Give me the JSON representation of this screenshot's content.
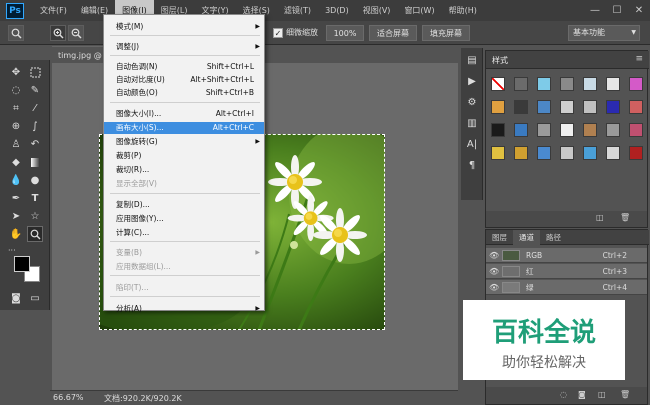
{
  "app": {
    "logo": "Ps"
  },
  "menubar": {
    "items": [
      "文件(F)",
      "编辑(E)",
      "图像(I)",
      "图层(L)",
      "文字(Y)",
      "选择(S)",
      "滤镜(T)",
      "3D(D)",
      "视图(V)",
      "窗口(W)",
      "帮助(H)"
    ],
    "active_index": 2,
    "window_controls": {
      "minimize": "—",
      "maximize": "☐",
      "close": "✕"
    }
  },
  "options_bar": {
    "tool_icon": "zoom-icon",
    "checkbox_label": "细微缩放",
    "zoom_percent_button": "100%",
    "fit_screen_button": "适合屏幕",
    "fill_screen_button": "填充屏幕",
    "workspace": "基本功能"
  },
  "document": {
    "tab_label": "timg.jpg @ 6",
    "zoom": "66.67%",
    "doc_info": "文档:920.2K/920.2K"
  },
  "image_menu": {
    "items": [
      {
        "label": "模式(M)",
        "shortcut": "",
        "submenu": true,
        "disabled": false
      },
      {
        "label": "调整(J)",
        "shortcut": "",
        "submenu": true,
        "disabled": false
      },
      {
        "label": "自动色调(N)",
        "shortcut": "Shift+Ctrl+L",
        "submenu": false,
        "disabled": false
      },
      {
        "label": "自动对比度(U)",
        "shortcut": "Alt+Shift+Ctrl+L",
        "submenu": false,
        "disabled": false
      },
      {
        "label": "自动颜色(O)",
        "shortcut": "Shift+Ctrl+B",
        "submenu": false,
        "disabled": false
      },
      {
        "label": "图像大小(I)...",
        "shortcut": "Alt+Ctrl+I",
        "submenu": false,
        "disabled": false
      },
      {
        "label": "画布大小(S)...",
        "shortcut": "Alt+Ctrl+C",
        "submenu": false,
        "disabled": false,
        "highlighted": true
      },
      {
        "label": "图像旋转(G)",
        "shortcut": "",
        "submenu": true,
        "disabled": false
      },
      {
        "label": "裁剪(P)",
        "shortcut": "",
        "submenu": false,
        "disabled": false
      },
      {
        "label": "裁切(R)...",
        "shortcut": "",
        "submenu": false,
        "disabled": false
      },
      {
        "label": "显示全部(V)",
        "shortcut": "",
        "submenu": false,
        "disabled": true
      },
      {
        "label": "复制(D)...",
        "shortcut": "",
        "submenu": false,
        "disabled": false
      },
      {
        "label": "应用图像(Y)...",
        "shortcut": "",
        "submenu": false,
        "disabled": false
      },
      {
        "label": "计算(C)...",
        "shortcut": "",
        "submenu": false,
        "disabled": false
      },
      {
        "label": "变量(B)",
        "shortcut": "",
        "submenu": true,
        "disabled": true
      },
      {
        "label": "应用数据组(L)...",
        "shortcut": "",
        "submenu": false,
        "disabled": true
      },
      {
        "label": "陷印(T)...",
        "shortcut": "",
        "submenu": false,
        "disabled": true
      },
      {
        "label": "分析(A)",
        "shortcut": "",
        "submenu": true,
        "disabled": false
      }
    ]
  },
  "styles_panel": {
    "tab": "样式"
  },
  "channels_panel": {
    "tabs": [
      "图层",
      "通道",
      "路径"
    ],
    "active_tab": 1,
    "channels": [
      {
        "name": "RGB",
        "shortcut": "Ctrl+2"
      },
      {
        "name": "红",
        "shortcut": "Ctrl+3"
      },
      {
        "name": "绿",
        "shortcut": "Ctrl+4"
      }
    ]
  },
  "watermark": {
    "title": "百科全说",
    "subtitle": "助你轻松解决"
  },
  "colors": {
    "menu_highlight": "#3d8ee0",
    "watermark_green": "#1f9e78"
  }
}
